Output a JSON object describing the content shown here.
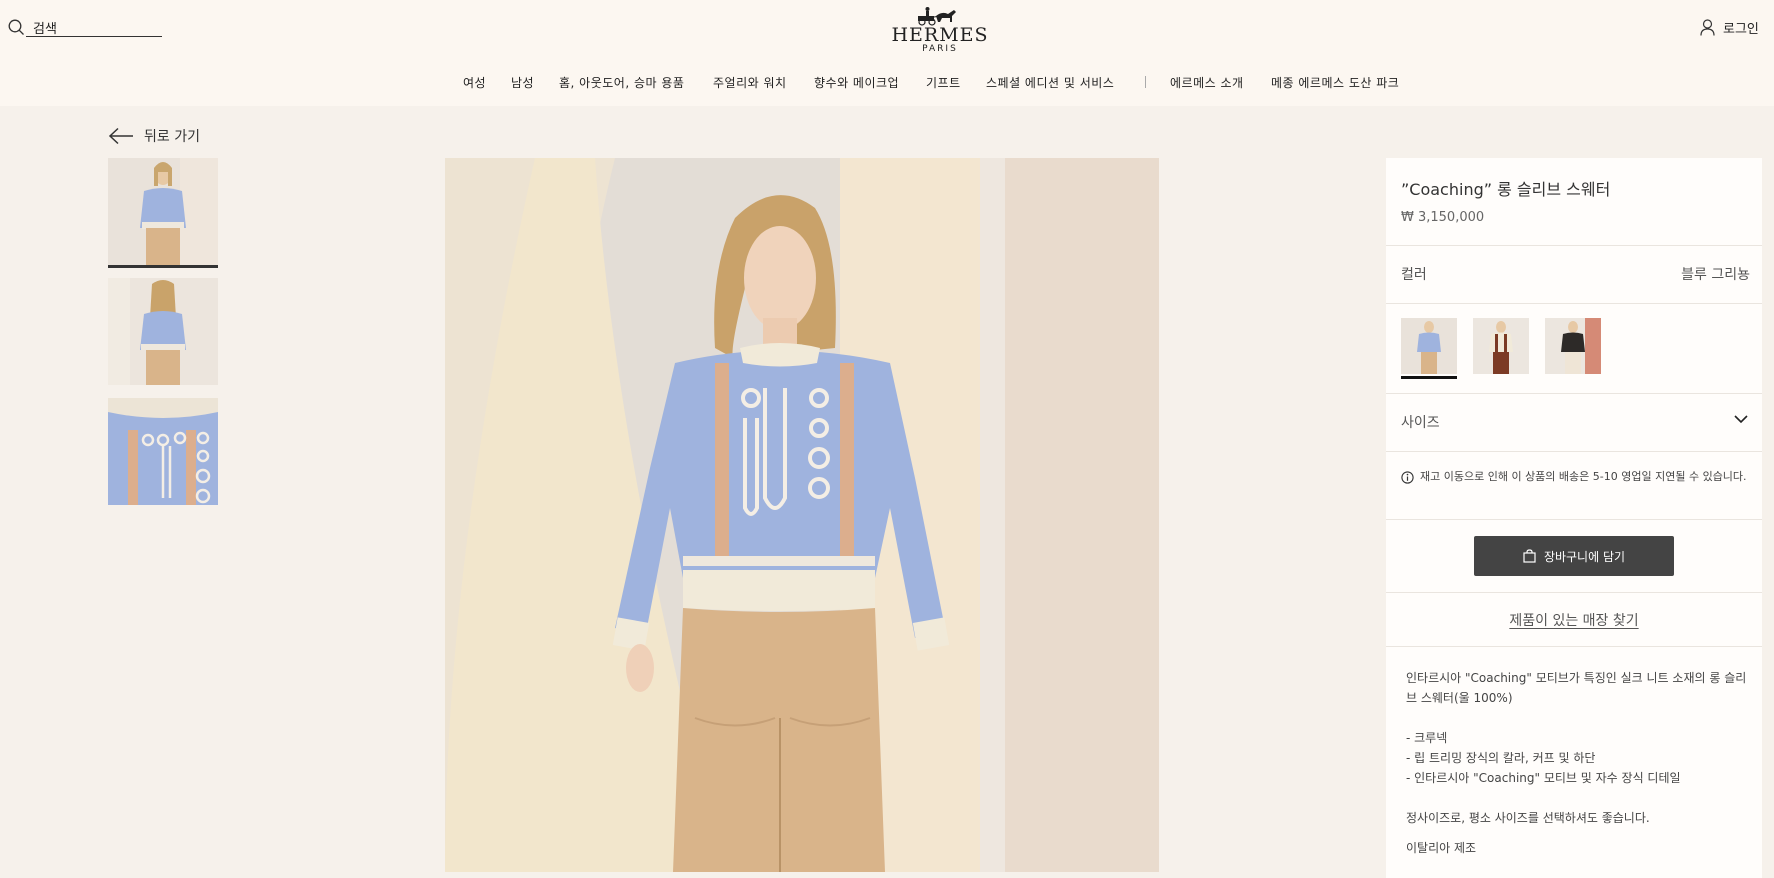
{
  "header": {
    "search_placeholder": "검색",
    "logo_text": "HERMES",
    "logo_sub": "PARIS",
    "login_label": "로그인",
    "search_icon": "search-icon",
    "user_icon": "user-icon"
  },
  "nav": {
    "items": [
      "여성",
      "남성",
      "홈, 아웃도어, 승마 용품",
      "주얼리와 워치",
      "향수와 메이크업",
      "기프트",
      "스페셜 에디션 및 서비스"
    ],
    "secondary": [
      "에르메스 소개",
      "메종 에르메스 도산 파크"
    ]
  },
  "back": {
    "label": "뒤로 가기"
  },
  "product": {
    "title": "”Coaching” 롱 슬리브 스웨터",
    "price": "₩ 3,150,000",
    "color_label": "컬러",
    "color_value": "블루 그리뇽",
    "size_label": "사이즈",
    "notice": "재고 이동으로 인해 이 상품의 배송은 5-10 영업일 지연될 수 있습니다.",
    "cart_label": "장바구니에 담기",
    "store_label": "제품이 있는 매장 찾기",
    "desc_intro": "인타르시아 \"Coaching\" 모티브가 특징인 실크 니트 소재의 롱 슬리브 스웨터(울 100%)",
    "desc_bullets": [
      "- 크루넥",
      "- 립 트리밍 장식의 칼라, 커프 및 하단",
      "- 인타르시아 \"Coaching\" 모티브 및 자수 장식 디테일"
    ],
    "desc_fit": "정사이즈로, 평소 사이즈를 선택하셔도 좋습니다.",
    "desc_origin": "이탈리아 제조"
  },
  "colors": {
    "accent": "#444444",
    "page_bg": "#f6f1eb",
    "header_bg": "#fcf7f1",
    "sweater_blue": "#9fb3de",
    "skirt_tan": "#d9b48a"
  }
}
